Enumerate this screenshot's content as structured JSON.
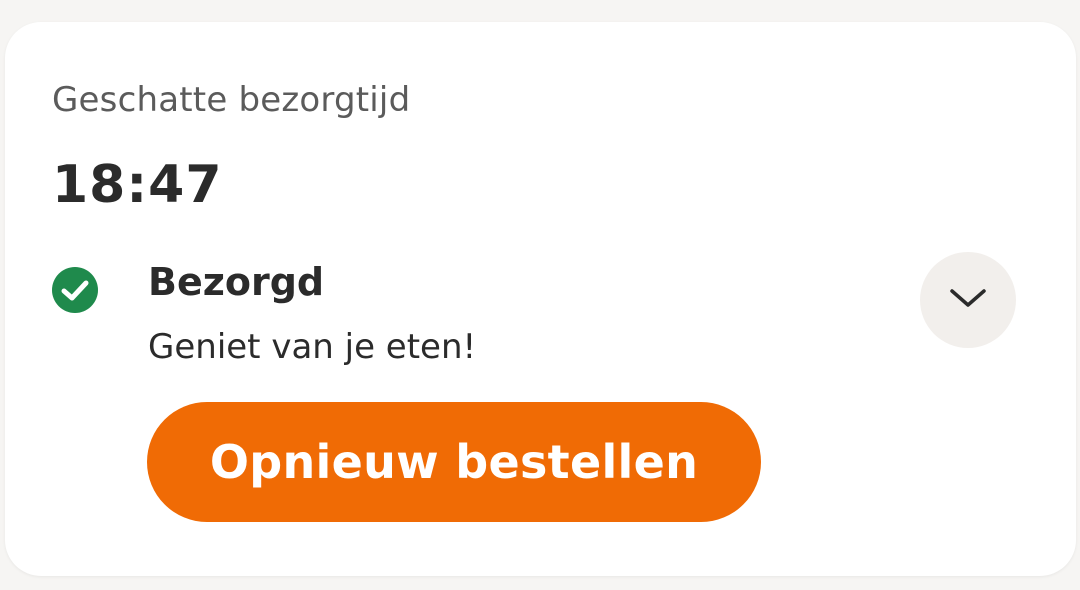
{
  "delivery": {
    "estimate_label": "Geschatte bezorgtijd",
    "estimate_time": "18:47",
    "status_icon": "check-circle-icon",
    "status_title": "Bezorgd",
    "status_subtitle": "Geniet van je eten!",
    "expand_icon": "chevron-down-icon",
    "reorder_label": "Opnieuw bestellen"
  },
  "colors": {
    "accent": "#f06b05",
    "success": "#1f8a4c",
    "text": "#2b2b2b",
    "muted": "#5b5b5b"
  }
}
